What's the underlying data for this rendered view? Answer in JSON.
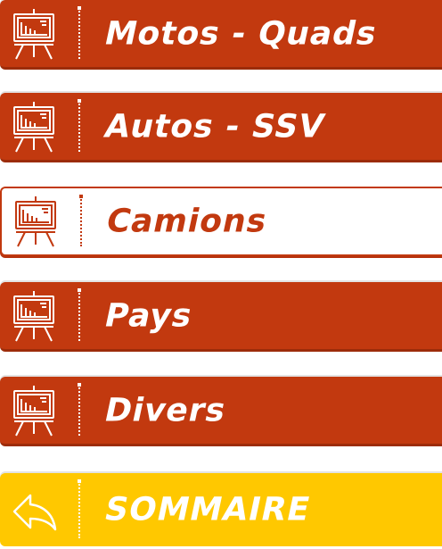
{
  "menu": {
    "items": [
      {
        "label": "Motos - Quads",
        "icon": "presentation-board-icon",
        "style": "filled"
      },
      {
        "label": "Autos - SSV",
        "icon": "presentation-board-icon",
        "style": "filled"
      },
      {
        "label": "Camions",
        "icon": "presentation-board-icon",
        "style": "outlined"
      },
      {
        "label": "Pays",
        "icon": "presentation-board-icon",
        "style": "filled"
      },
      {
        "label": "Divers",
        "icon": "presentation-board-icon",
        "style": "filled"
      }
    ],
    "back": {
      "label": "SOMMAIRE",
      "icon": "back-arrow-icon"
    }
  },
  "colors": {
    "primary": "#c2390f",
    "accent": "#ffc800",
    "text_on_primary": "#ffffff"
  }
}
